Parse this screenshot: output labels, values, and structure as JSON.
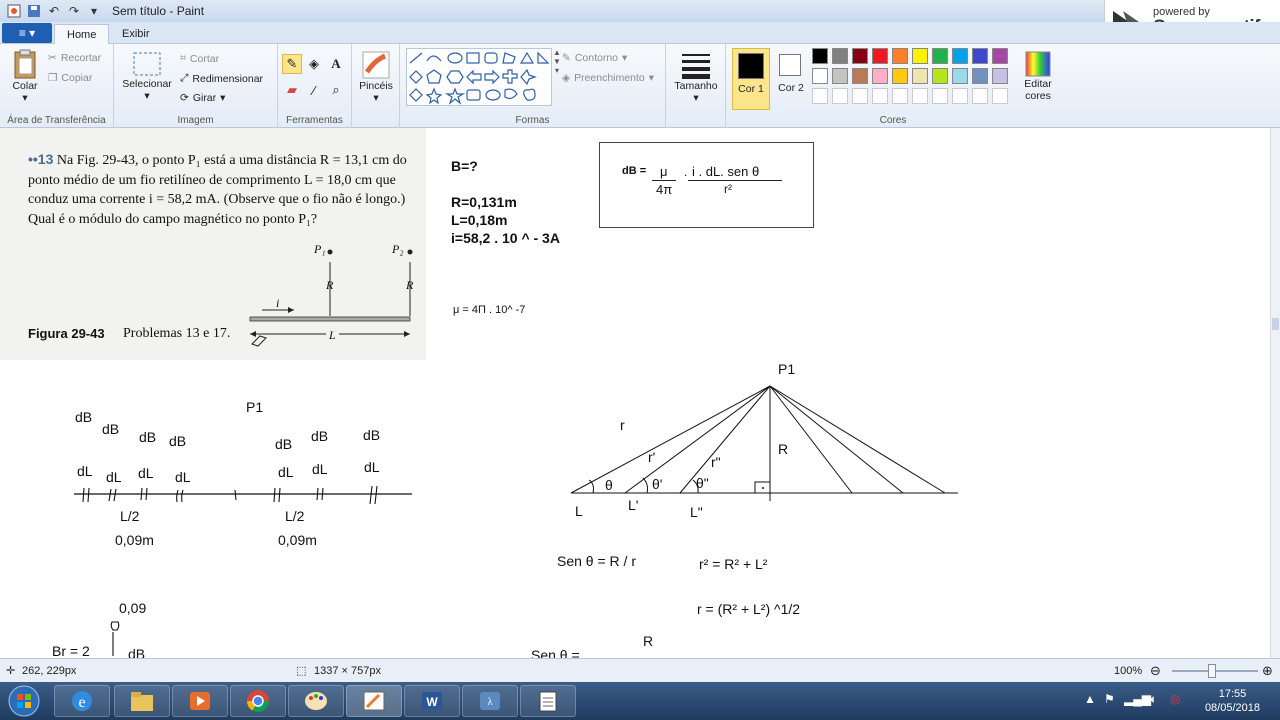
{
  "window": {
    "title": "Sem título - Paint"
  },
  "branding": {
    "powered_by": "powered by",
    "name": "Screencastify"
  },
  "tabs": {
    "file": "≡ ▾",
    "home": "Home",
    "view": "Exibir"
  },
  "ribbon": {
    "clipboard": {
      "label": "Área de Transferência",
      "paste": "Colar",
      "cut": "Recortar",
      "copy": "Copiar"
    },
    "image": {
      "label": "Imagem",
      "select": "Selecionar",
      "crop": "Cortar",
      "resize": "Redimensionar",
      "rotate": "Girar"
    },
    "tools": {
      "label": "Ferramentas"
    },
    "brushes": {
      "label": "Pincéis"
    },
    "shapes": {
      "label": "Formas",
      "outline": "Contorno",
      "fill": "Preenchimento"
    },
    "size": {
      "label": "Tamanho"
    },
    "colors": {
      "label": "Cores",
      "color1": "Cor 1",
      "color2": "Cor 2",
      "edit": "Editar cores",
      "palette_row1": [
        "#000000",
        "#7f7f7f",
        "#880015",
        "#ed1c24",
        "#ff7f27",
        "#fff200",
        "#22b14c",
        "#00a2e8",
        "#3f48cc",
        "#a349a4"
      ],
      "palette_row2": [
        "#ffffff",
        "#c3c3c3",
        "#b97a57",
        "#ffaec9",
        "#ffc90e",
        "#efe4b0",
        "#b5e61d",
        "#99d9ea",
        "#7092be",
        "#c8bfe7"
      ]
    }
  },
  "canvas": {
    "book": {
      "number": "••13",
      "text": "Na Fig. 29-43, o ponto P₁ está a uma distância R = 13,1 cm do ponto médio de um fio retilíneo de comprimento L = 18,0 cm que conduz uma corrente i = 58,2 mA. (Observe que o fio não é longo.) Qual é o módulo do campo magnético no ponto P₁?",
      "fig_label": "Figura 29-43",
      "fig_caption": "Problemas 13 e 17.",
      "p1": "P₁",
      "p2": "P₂",
      "r1": "R",
      "r2": "R",
      "i": "i",
      "l": "L"
    },
    "given": {
      "b": "B=?",
      "r": "R=0,131m",
      "l": "L=0,18m",
      "i": "i=58,2 . 10 ^ - 3A",
      "mu": "μ = 4Π . 10^ -7"
    },
    "formula": {
      "lhs": "dB =",
      "num1": "μ",
      "den1": "4π",
      "dot": ".",
      "num2": "i . dL. sen θ",
      "den2": "r²"
    },
    "left_sketch": {
      "p1": "P1",
      "db": [
        "dB",
        "dB",
        "dB",
        "dB",
        "dB",
        "dB",
        "dB"
      ],
      "dl": [
        "dL",
        "dL",
        "dL",
        "dL",
        "dL",
        "dL",
        "dL"
      ],
      "half1": "L/2",
      "half2": "L/2",
      "len1": "0,09m",
      "len2": "0,09m",
      "bottom_val": "0,09",
      "br": "Br = 2",
      "bottom_db": "dB"
    },
    "triangle": {
      "p1": "P1",
      "r": "r",
      "r1": "r'",
      "r2": "r\"",
      "big_r": "R",
      "t": "θ",
      "t1": "θ'",
      "t2": "θ\"",
      "l": "L",
      "l1": "L'",
      "l2": "L\""
    },
    "equations": {
      "sen": "Sen θ = R / r",
      "pyth": "r² = R² + L²",
      "r_eq": "r = (R² + L²) ^1/2",
      "r_cut": "R",
      "sen_cut": "Sen θ ="
    }
  },
  "status": {
    "cursor": "262, 229px",
    "size": "1337 × 757px",
    "zoom": "100%"
  },
  "taskbar": {
    "time": "17:55",
    "date": "08/05/2018"
  }
}
